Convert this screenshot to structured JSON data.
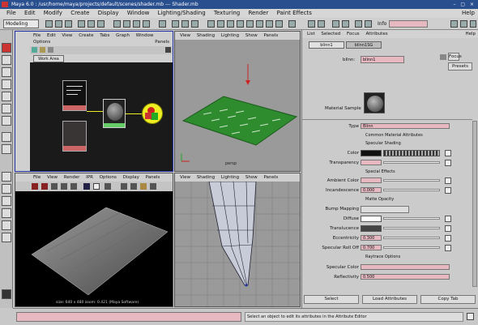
{
  "window": {
    "title": "Maya 6.0 : /usr/home/maya/projects/default/scenes/shader.mb --- Shader.mb",
    "controls": "– ▢ ×"
  },
  "menubar": [
    "File",
    "Edit",
    "Modify",
    "Create",
    "Display",
    "Window",
    "Lighting/Shading",
    "Texturing",
    "Render",
    "Paint Effects"
  ],
  "menubar_right": "Help",
  "status": {
    "mode": "Modeling",
    "field_label": "Info"
  },
  "hypershade": {
    "menu": [
      "File",
      "Edit",
      "View",
      "Create",
      "Tabs",
      "Graph",
      "Window"
    ],
    "menu2": "Options",
    "menu2_right": "Panels",
    "tab": "Work Area"
  },
  "viewport_persp": {
    "menu": [
      "View",
      "Shading",
      "Lighting",
      "Show",
      "Panels"
    ],
    "label": "persp"
  },
  "viewport_side": {
    "menu": [
      "View",
      "Shading",
      "Lighting",
      "Show",
      "Panels"
    ]
  },
  "render_view": {
    "menu": [
      "File",
      "View",
      "Render",
      "IPR",
      "Options",
      "Display",
      "Panels"
    ],
    "caption": "size: 640 x 480  zoom: 0.421  (Maya Software)"
  },
  "attribute_editor": {
    "menu": [
      "List",
      "Selected",
      "Focus",
      "Attributes"
    ],
    "menu_right": "Help",
    "tabs": [
      "blinn1",
      "blinn1SG"
    ],
    "shader_label": "blinn:",
    "shader_name": "blinn1",
    "focus_btn": "Focus",
    "presets_btn": "Presets",
    "sample_label": "Material Sample",
    "rows": [
      {
        "label": "Type",
        "value": "Blinn"
      },
      {
        "label": "Color",
        "value": ""
      },
      {
        "label": "Transparency",
        "value": ""
      },
      {
        "label": "Ambient Color",
        "value": ""
      },
      {
        "label": "Incandescence",
        "value": "0.000"
      },
      {
        "label": "Bump Mapping",
        "value": ""
      },
      {
        "label": "Diffuse",
        "value": "0.800"
      },
      {
        "label": "Translucence",
        "value": "0.000"
      },
      {
        "label": "Eccentricity",
        "value": "0.300"
      },
      {
        "label": "Specular Roll Off",
        "value": "0.700"
      },
      {
        "label": "Specular Color",
        "value": ""
      },
      {
        "label": "Reflectivity",
        "value": "0.500"
      }
    ],
    "section_labels": [
      "Common Material Attributes",
      "Specular Shading",
      "Special Effects",
      "Matte Opacity",
      "Raytrace Options"
    ],
    "buttons": [
      "Select",
      "Load Attributes",
      "Copy Tab"
    ]
  },
  "bottom": {
    "help_text": "Select an object to edit its attributes in the Attribute Editor"
  },
  "colors": {
    "title_bar": "#2a4f8f",
    "accent_pink": "#e8b8c0",
    "plane_green": "#2e8b2e"
  },
  "icons": [
    "maya-logo-icon",
    "select-tool-icon",
    "lasso-tool-icon",
    "move-tool-icon",
    "rotate-tool-icon",
    "scale-tool-icon",
    "render-icon"
  ]
}
